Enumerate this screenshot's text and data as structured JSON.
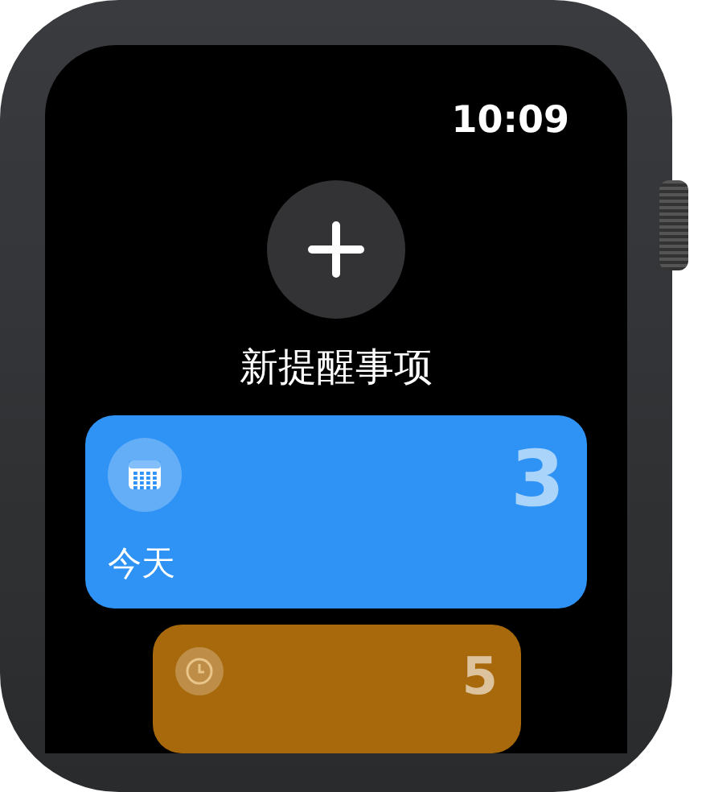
{
  "status_bar": {
    "time": "10:09"
  },
  "new_reminder": {
    "label": "新提醒事项"
  },
  "lists": [
    {
      "kind": "today",
      "name": "今天",
      "count": "3",
      "color": "#2f93f5"
    },
    {
      "kind": "scheduled",
      "count": "5",
      "color": "#a8690c"
    }
  ]
}
